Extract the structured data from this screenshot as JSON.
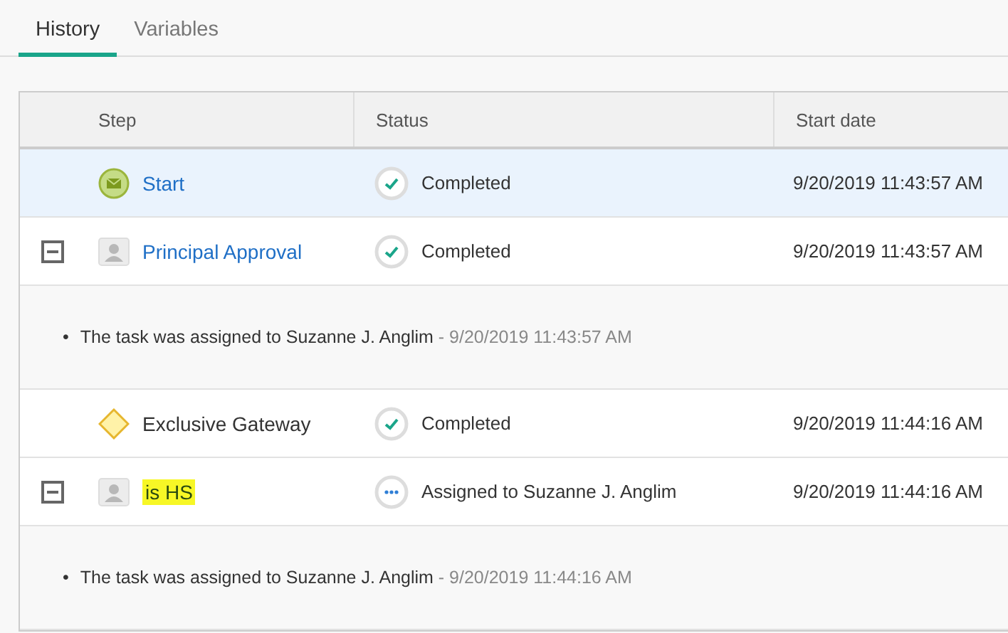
{
  "tabs": [
    {
      "label": "History",
      "selected": true
    },
    {
      "label": "Variables",
      "selected": false
    }
  ],
  "table": {
    "columns": [
      "Step",
      "Status",
      "Start date"
    ],
    "rows": [
      {
        "step": "Start",
        "kind": "start",
        "link": true,
        "highlighted": false,
        "selected": true,
        "status": {
          "kind": "completed",
          "text": "Completed"
        },
        "start_date": "9/20/2019 11:43:57 AM"
      },
      {
        "step": "Principal Approval",
        "kind": "user-task",
        "link": true,
        "highlighted": false,
        "selected": false,
        "expanded": true,
        "status": {
          "kind": "completed",
          "text": "Completed"
        },
        "start_date": "9/20/2019 11:43:57 AM",
        "log": [
          {
            "bullet": "•",
            "text": "The task was assigned to Suzanne J. Anglim",
            "time": "- 9/20/2019 11:43:57 AM"
          }
        ]
      },
      {
        "step": "Exclusive Gateway",
        "kind": "gateway",
        "link": false,
        "highlighted": false,
        "selected": false,
        "status": {
          "kind": "completed",
          "text": "Completed"
        },
        "start_date": "9/20/2019 11:44:16 AM"
      },
      {
        "step": "is HS",
        "kind": "user-task",
        "link": false,
        "highlighted": true,
        "selected": false,
        "expanded": true,
        "status": {
          "kind": "pending",
          "text": "Assigned to Suzanne J. Anglim"
        },
        "start_date": "9/20/2019 11:44:16 AM",
        "log": [
          {
            "bullet": "•",
            "text": "The task was assigned to Suzanne J. Anglim",
            "time": "- 9/20/2019 11:44:16 AM"
          }
        ]
      }
    ]
  }
}
